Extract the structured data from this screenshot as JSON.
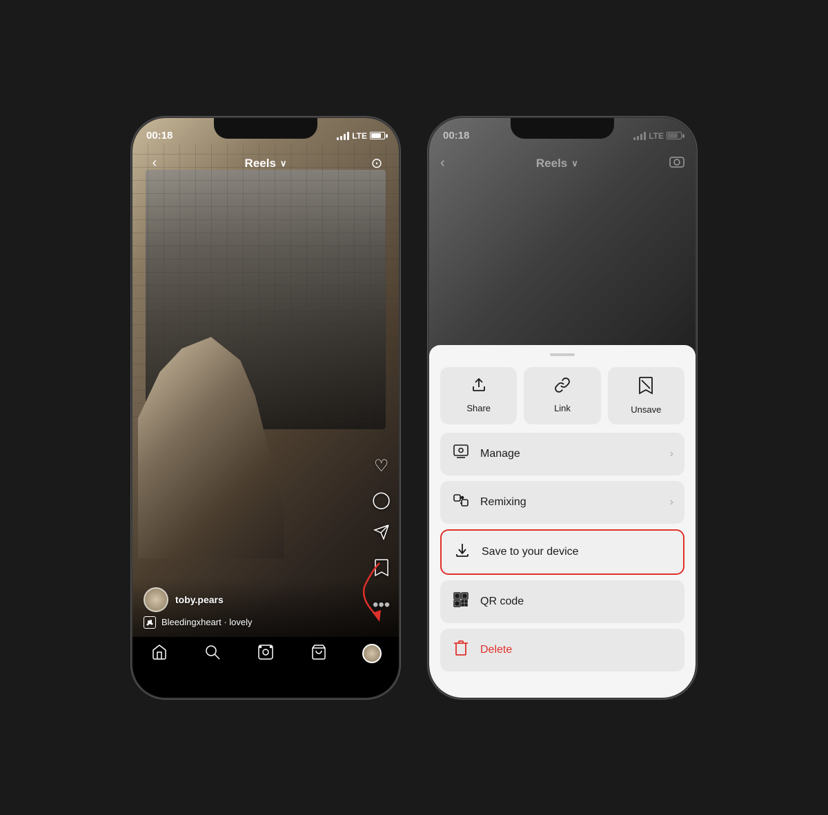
{
  "phone1": {
    "status_time": "00:18",
    "lte": "LTE",
    "nav_back": "‹",
    "nav_title": "Reels",
    "nav_chevron": "∨",
    "nav_camera": "⊙",
    "username": "toby.pears",
    "song_text": "Bleedingxheart · lovely",
    "tabs": [
      "⌂",
      "🔍",
      "▷",
      "🛍",
      ""
    ],
    "actions": [
      "♡",
      "○",
      "➤",
      "⊠"
    ]
  },
  "phone2": {
    "status_time": "00:18",
    "lte": "LTE",
    "nav_title": "Reels",
    "sheet": {
      "handle": "",
      "top_buttons": [
        {
          "icon": "↑",
          "label": "Share"
        },
        {
          "icon": "⛓",
          "label": "Link"
        },
        {
          "icon": "⊠",
          "label": "Unsave"
        }
      ],
      "list_items": [
        {
          "icon": "▶",
          "label": "Manage",
          "chevron": "›",
          "highlighted": false,
          "delete": false
        },
        {
          "icon": "↺",
          "label": "Remixing",
          "chevron": "›",
          "highlighted": false,
          "delete": false
        },
        {
          "icon": "⊻",
          "label": "Save to your device",
          "chevron": "",
          "highlighted": true,
          "delete": false
        },
        {
          "icon": "⊞",
          "label": "QR code",
          "chevron": "",
          "highlighted": false,
          "delete": false
        },
        {
          "icon": "🗑",
          "label": "Delete",
          "chevron": "",
          "highlighted": false,
          "delete": true
        }
      ]
    }
  }
}
